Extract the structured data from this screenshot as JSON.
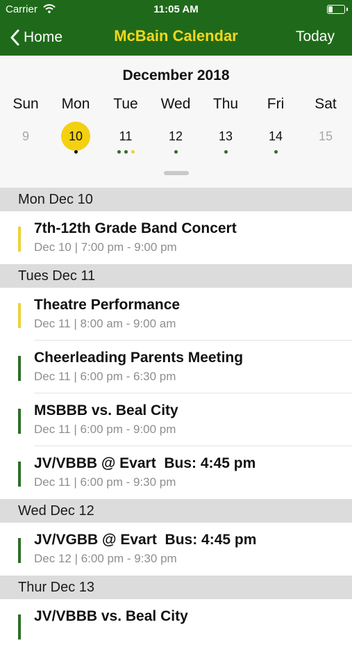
{
  "status": {
    "carrier": "Carrier",
    "time": "11:05 AM"
  },
  "nav": {
    "back_label": "Home",
    "title": "McBain Calendar",
    "today_label": "Today"
  },
  "colors": {
    "brand_green": "#1f6a1a",
    "accent_yellow": "#f3d110",
    "event_green": "#2d6e27",
    "event_yellow": "#ecd23b",
    "dot_black": "#111111"
  },
  "calendar": {
    "month_label": "December 2018",
    "weekdays": [
      "Sun",
      "Mon",
      "Tue",
      "Wed",
      "Thu",
      "Fri",
      "Sat"
    ],
    "days": [
      {
        "num": "9",
        "muted": true,
        "selected": false,
        "dots": []
      },
      {
        "num": "10",
        "muted": false,
        "selected": true,
        "dots": [
          "black"
        ]
      },
      {
        "num": "11",
        "muted": false,
        "selected": false,
        "dots": [
          "green",
          "green",
          "yellow"
        ]
      },
      {
        "num": "12",
        "muted": false,
        "selected": false,
        "dots": [
          "green"
        ]
      },
      {
        "num": "13",
        "muted": false,
        "selected": false,
        "dots": [
          "green"
        ]
      },
      {
        "num": "14",
        "muted": false,
        "selected": false,
        "dots": [
          "green"
        ]
      },
      {
        "num": "15",
        "muted": true,
        "selected": false,
        "dots": []
      }
    ]
  },
  "sections": [
    {
      "header": "Mon Dec 10",
      "events": [
        {
          "title": "7th-12th Grade Band Concert",
          "time": "Dec 10 | 7:00 pm - 9:00 pm",
          "color": "yellow"
        }
      ]
    },
    {
      "header": "Tues Dec 11",
      "events": [
        {
          "title": "Theatre Performance",
          "time": "Dec 11 | 8:00 am - 9:00 am",
          "color": "yellow"
        },
        {
          "title": "Cheerleading Parents Meeting",
          "time": "Dec 11 | 6:00 pm - 6:30 pm",
          "color": "green"
        },
        {
          "title": "MSBBB vs. Beal City",
          "time": "Dec 11 | 6:00 pm - 9:00 pm",
          "color": "green"
        },
        {
          "title": "JV/VBBB @ Evart  Bus: 4:45 pm",
          "time": "Dec 11 | 6:00 pm - 9:30 pm",
          "color": "green"
        }
      ]
    },
    {
      "header": "Wed Dec 12",
      "events": [
        {
          "title": "JV/VGBB @ Evart  Bus: 4:45 pm",
          "time": "Dec 12 | 6:00 pm - 9:30 pm",
          "color": "green"
        }
      ]
    },
    {
      "header": "Thur Dec 13",
      "events": [
        {
          "title": "JV/VBBB vs. Beal City",
          "time": "",
          "color": "green"
        }
      ]
    }
  ]
}
